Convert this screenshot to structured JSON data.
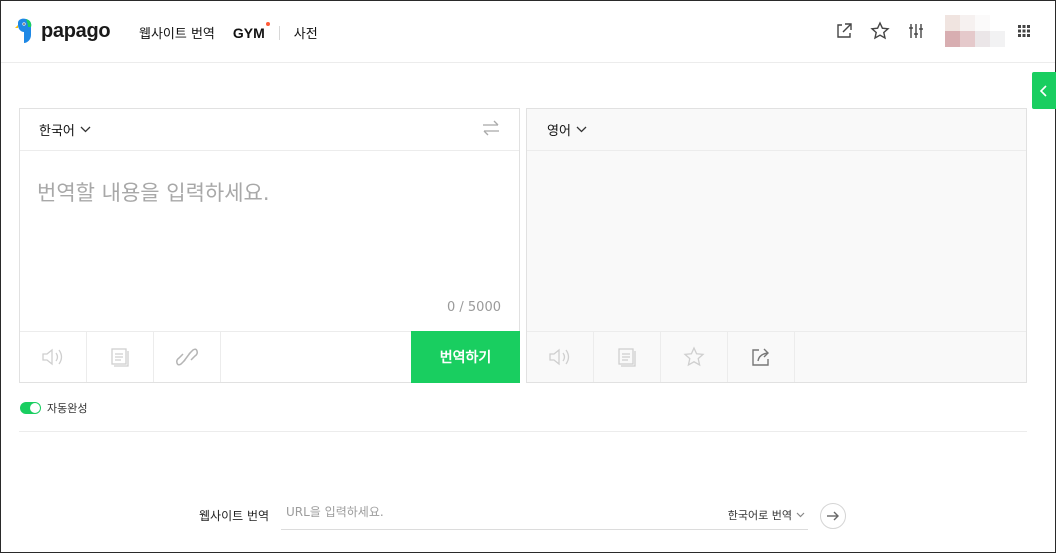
{
  "header": {
    "logo_text": "papago",
    "nav": {
      "website_translate": "웹사이트 번역",
      "gym": "GYM",
      "dictionary": "사전"
    },
    "icons": [
      "external-link-icon",
      "star-icon",
      "settings-sliders-icon",
      "apps-grid-icon"
    ],
    "accent_color": "#19ce60"
  },
  "source_panel": {
    "language": "한국어",
    "placeholder": "번역할 내용을 입력하세요.",
    "counter": "0 / 5000",
    "translate_button": "번역하기"
  },
  "target_panel": {
    "language": "영어"
  },
  "autocomplete": {
    "label": "자동완성",
    "enabled": true
  },
  "website_translate": {
    "label": "웹사이트 번역",
    "placeholder": "URL을 입력하세요.",
    "language_select": "한국어로 번역"
  }
}
